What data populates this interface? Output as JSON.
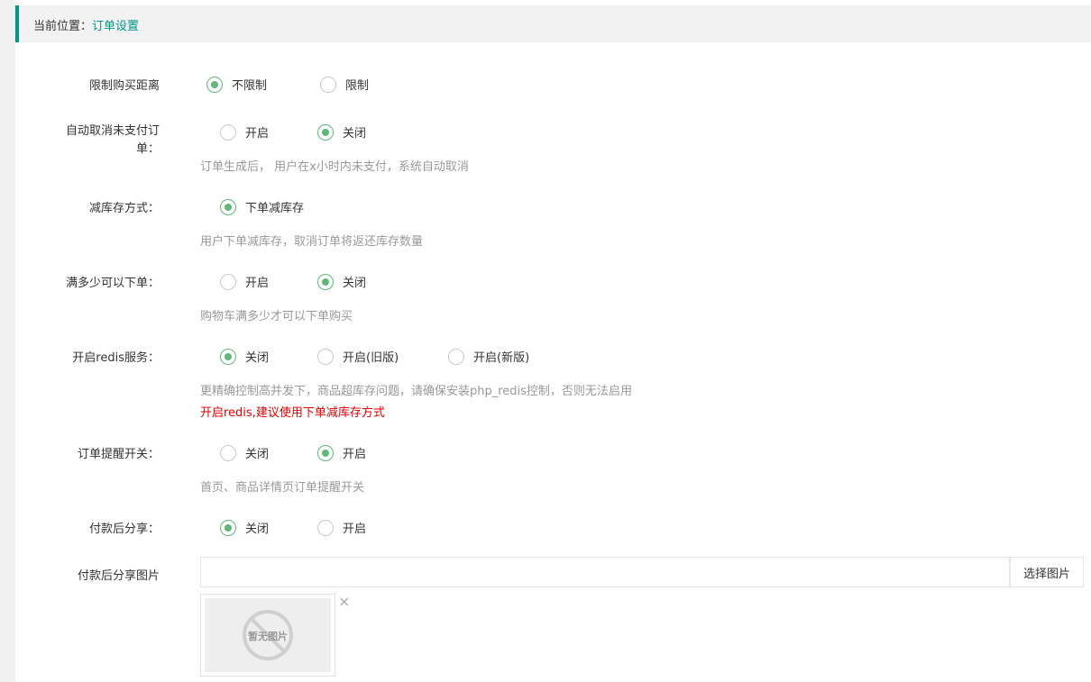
{
  "breadcrumb": {
    "prefix": "当前位置：",
    "current": "订单设置"
  },
  "settings": {
    "limit_distance": {
      "label": "限制购买距离",
      "options": [
        "不限制",
        "限制"
      ],
      "selected": 0
    },
    "auto_cancel": {
      "label": "自动取消未支付订单：",
      "options": [
        "开启",
        "关闭"
      ],
      "selected": 1,
      "hint": "订单生成后， 用户在x小时内未支付，系统自动取消"
    },
    "stock_mode": {
      "label": "减库存方式：",
      "options": [
        "下单减库存"
      ],
      "selected": 0,
      "hint": "用户下单减库存，取消订单将返还库存数量"
    },
    "min_order": {
      "label": "满多少可以下单：",
      "options": [
        "开启",
        "关闭"
      ],
      "selected": 1,
      "hint": "购物车满多少才可以下单购买"
    },
    "redis": {
      "label": "开启redis服务：",
      "options": [
        "关闭",
        "开启(旧版)",
        "开启(新版)"
      ],
      "selected": 0,
      "hint": "更精确控制高并发下，商品超库存问题，请确保安装php_redis控制，否则无法启用",
      "warning": "开启redis,建议使用下单减库存方式"
    },
    "order_reminder": {
      "label": "订单提醒开关：",
      "options": [
        "关闭",
        "开启"
      ],
      "selected": 1,
      "hint": "首页、商品详情页订单提醒开关"
    },
    "share_after_pay": {
      "label": "付款后分享：",
      "options": [
        "关闭",
        "开启"
      ],
      "selected": 0
    },
    "share_image": {
      "label": "付款后分享图片",
      "value": "",
      "button": "选择图片",
      "placeholder_text": "暂无图片",
      "close": "×"
    }
  },
  "colors": {
    "accent": "#009688",
    "radio_checked": "#5FB878",
    "hint": "#999999",
    "warning": "#e00000"
  }
}
